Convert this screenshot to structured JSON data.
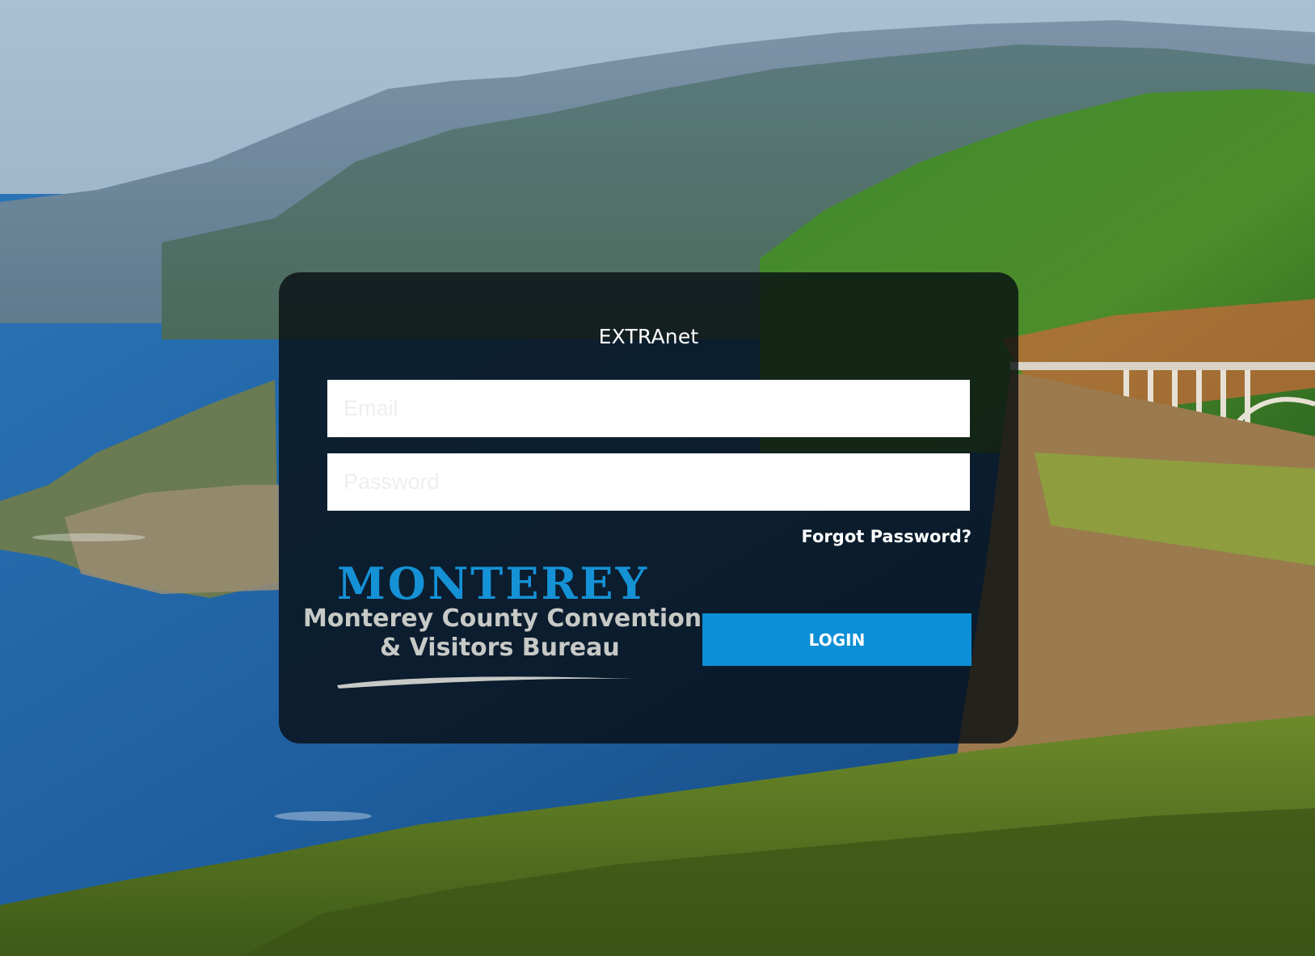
{
  "login": {
    "title": "EXTRAnet",
    "email_placeholder": "Email",
    "password_placeholder": "Password",
    "forgot_password": "Forgot Password?",
    "login_button": "LOGIN"
  },
  "logo": {
    "wordmark": "MONTEREY",
    "line1": "Monterey County Convention",
    "line2": "& Visitors Bureau"
  },
  "colors": {
    "accent": "#0c8fd6",
    "logo_blue": "#1591d6",
    "card_background": "rgba(6,12,18,0.80)"
  }
}
